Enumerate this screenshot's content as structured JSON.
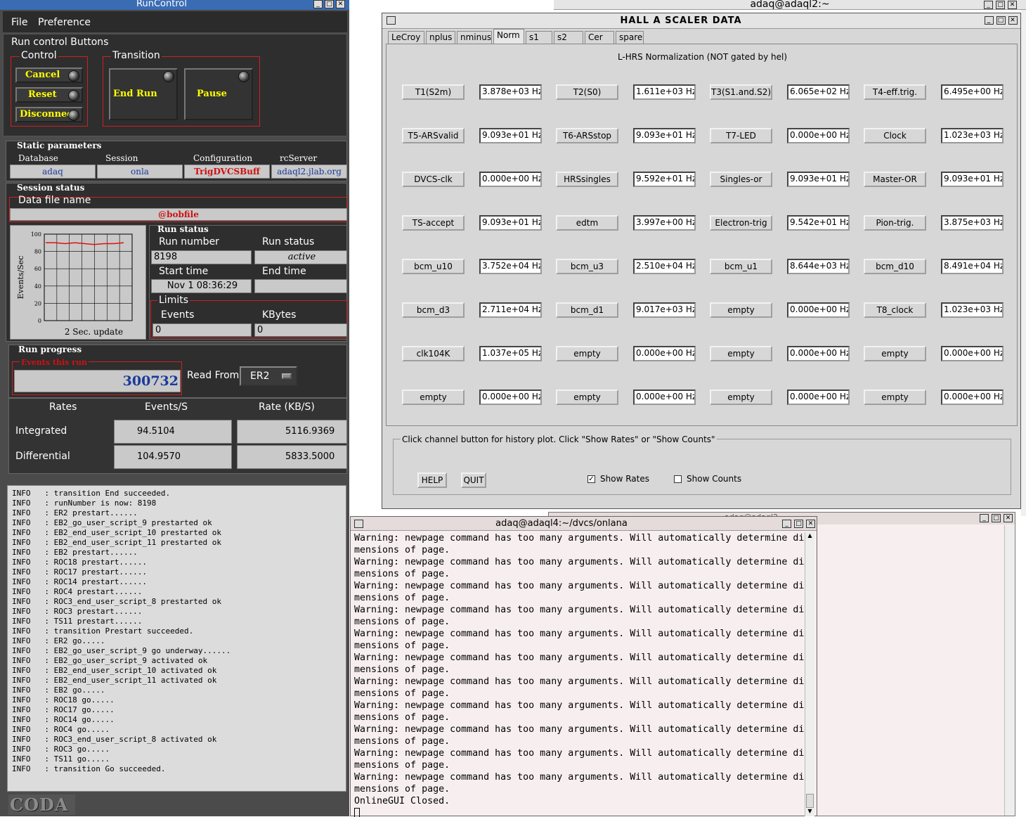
{
  "runcontrol": {
    "title": "RunControl",
    "menu": {
      "file": "File",
      "preference": "Preference"
    },
    "run_control_buttons": "Run control Buttons",
    "control": {
      "label": "Control",
      "cancel": "Cancel",
      "reset": "Reset",
      "disconnect": "Disconnect"
    },
    "transition": {
      "label": "Transition",
      "end_run": "End Run",
      "pause": "Pause"
    },
    "static_params": {
      "label": "Static parameters",
      "database_label": "Database",
      "database": "adaq",
      "session_label": "Session",
      "session": "onla",
      "config_label": "Configuration",
      "config": "TrigDVCSBuff",
      "rcserver_label": "rcServer",
      "rcserver": "adaql2.jlab.org"
    },
    "session_status": {
      "label": "Session status",
      "data_file_label": "Data file name",
      "data_file": "@bobfile"
    },
    "plot": {
      "ylabel": "Events/Sec",
      "yticks": [
        "100",
        "80",
        "60",
        "40",
        "20",
        "0"
      ],
      "caption": "2 Sec. update",
      "values": [
        90,
        90,
        89,
        90,
        89,
        88,
        89,
        89,
        90
      ]
    },
    "run_status": {
      "label": "Run status",
      "run_number_label": "Run number",
      "run_number": "8198",
      "run_status_label": "Run status",
      "run_status": "active",
      "start_time_label": "Start time",
      "start_time": "Nov 1 08:36:29",
      "end_time_label": "End time",
      "end_time": "",
      "limits_label": "Limits",
      "events_label": "Events",
      "events": "0",
      "kbytes_label": "KBytes",
      "kbytes": "0"
    },
    "run_progress": {
      "label": "Run progress",
      "events_this_run_label": "Events this run",
      "events_this_run": "300732",
      "read_from_label": "Read From:",
      "read_from": "ER2"
    },
    "rates": {
      "header": "Rates",
      "events_header": "Events/S",
      "rate_header": "Rate (KB/S)",
      "integrated_label": "Integrated",
      "integrated_events": "94.5104",
      "integrated_rate": "5116.9369",
      "differential_label": "Differential",
      "differential_events": "104.9570",
      "differential_rate": "5833.5000"
    },
    "log": [
      "INFO   : transition End succeeded.",
      "INFO   : runNumber is now: 8198",
      "INFO   : ER2 prestart......",
      "INFO   : EB2_go_user_script_9 prestarted ok",
      "INFO   : EB2_end_user_script_10 prestarted ok",
      "INFO   : EB2_end_user_script_11 prestarted ok",
      "INFO   : EB2 prestart......",
      "INFO   : ROC18 prestart......",
      "INFO   : ROC17 prestart......",
      "INFO   : ROC14 prestart......",
      "INFO   : ROC4 prestart......",
      "INFO   : ROC3_end_user_script_8 prestarted ok",
      "INFO   : ROC3 prestart......",
      "INFO   : TS11 prestart......",
      "INFO   : transition Prestart succeeded.",
      "INFO   : ER2 go.....",
      "INFO   : EB2_go_user_script_9 go underway......",
      "INFO   : EB2_go_user_script_9 activated ok",
      "INFO   : EB2_end_user_script_10 activated ok",
      "INFO   : EB2_end_user_script_11 activated ok",
      "INFO   : EB2 go.....",
      "INFO   : ROC18 go.....",
      "INFO   : ROC17 go.....",
      "INFO   : ROC14 go.....",
      "INFO   : ROC4 go.....",
      "INFO   : ROC3_end_user_script_8 activated ok",
      "INFO   : ROC3 go.....",
      "INFO   : TS11 go.....",
      "INFO   : transition Go succeeded."
    ],
    "logo": "CODA"
  },
  "bg_windows": {
    "top_title": "adaq@adaql2:~",
    "mid_title": "adaq@adaql2"
  },
  "scaler": {
    "title": "HALL  A  SCALER  DATA",
    "tabs": [
      "LeCroy",
      "nplus",
      "nminus",
      "Norm",
      "s1",
      "s2",
      "Cer",
      "spare"
    ],
    "active_tab": "Norm",
    "heading": "L-HRS Normalization (NOT gated by hel)",
    "rows": [
      [
        [
          "T1(S2m)",
          "3.878e+03 Hz"
        ],
        [
          "T2(S0)",
          "1.611e+03 Hz"
        ],
        [
          "T3(S1.and.S2)",
          "6.065e+02 Hz"
        ],
        [
          "T4-eff.trig.",
          "6.495e+00 Hz"
        ]
      ],
      [
        [
          "T5-ARSvalid",
          "9.093e+01 Hz"
        ],
        [
          "T6-ARSstop",
          "9.093e+01 Hz"
        ],
        [
          "T7-LED",
          "0.000e+00 Hz"
        ],
        [
          "Clock",
          "1.023e+03 Hz"
        ]
      ],
      [
        [
          "DVCS-clk",
          "0.000e+00 Hz"
        ],
        [
          "HRSsingles",
          "9.592e+01 Hz"
        ],
        [
          "Singles-or",
          "9.093e+01 Hz"
        ],
        [
          "Master-OR",
          "9.093e+01 Hz"
        ]
      ],
      [
        [
          "TS-accept",
          "9.093e+01 Hz"
        ],
        [
          "edtm",
          "3.997e+00 Hz"
        ],
        [
          "Electron-trig",
          "9.542e+01 Hz"
        ],
        [
          "Pion-trig.",
          "3.875e+03 Hz"
        ]
      ],
      [
        [
          "bcm_u10",
          "3.752e+04 Hz"
        ],
        [
          "bcm_u3",
          "2.510e+04 Hz"
        ],
        [
          "bcm_u1",
          "8.644e+03 Hz"
        ],
        [
          "bcm_d10",
          "8.491e+04 Hz"
        ]
      ],
      [
        [
          "bcm_d3",
          "2.711e+04 Hz"
        ],
        [
          "bcm_d1",
          "9.017e+03 Hz"
        ],
        [
          "empty",
          "0.000e+00 Hz"
        ],
        [
          "T8_clock",
          "1.023e+03 Hz"
        ]
      ],
      [
        [
          "clk104K",
          "1.037e+05 Hz"
        ],
        [
          "empty",
          "0.000e+00 Hz"
        ],
        [
          "empty",
          "0.000e+00 Hz"
        ],
        [
          "empty",
          "0.000e+00 Hz"
        ]
      ],
      [
        [
          "empty",
          "0.000e+00 Hz"
        ],
        [
          "empty",
          "0.000e+00 Hz"
        ],
        [
          "empty",
          "0.000e+00 Hz"
        ],
        [
          "empty",
          "0.000e+00 Hz"
        ]
      ]
    ],
    "hint": "Click channel button for history plot.  Click \"Show Rates\" or \"Show Counts\"",
    "help": "HELP",
    "quit": "QUIT",
    "show_rates": "Show Rates",
    "show_rates_checked": true,
    "show_counts": "Show Counts",
    "show_counts_checked": false
  },
  "terminal": {
    "title": "adaq@adaql4:~/dvcs/onlana",
    "lines": [
      "Warning: newpage command has too many arguments. Will automatically determine di",
      "mensions of page.",
      "Warning: newpage command has too many arguments. Will automatically determine di",
      "mensions of page.",
      "Warning: newpage command has too many arguments. Will automatically determine di",
      "mensions of page.",
      "Warning: newpage command has too many arguments. Will automatically determine di",
      "mensions of page.",
      "Warning: newpage command has too many arguments. Will automatically determine di",
      "mensions of page.",
      "Warning: newpage command has too many arguments. Will automatically determine di",
      "mensions of page.",
      "Warning: newpage command has too many arguments. Will automatically determine di",
      "mensions of page.",
      "Warning: newpage command has too many arguments. Will automatically determine di",
      "mensions of page.",
      "Warning: newpage command has too many arguments. Will automatically determine di",
      "mensions of page.",
      "Warning: newpage command has too many arguments. Will automatically determine di",
      "mensions of page.",
      "Warning: newpage command has too many arguments. Will automatically determine di",
      "mensions of page.",
      "OnlineGUI Closed."
    ]
  }
}
